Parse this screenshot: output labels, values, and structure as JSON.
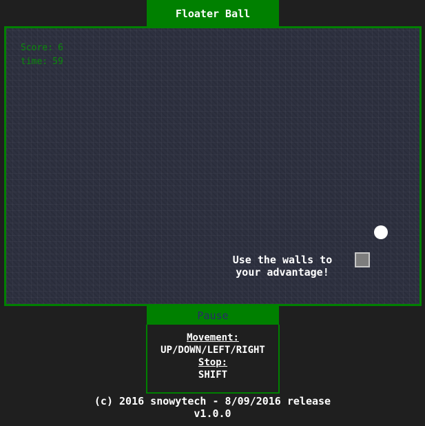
{
  "game": {
    "title": "Floater Ball",
    "hud": {
      "score_label": "Score:",
      "score_value": "6",
      "time_label": "time:",
      "time_value": "59"
    },
    "hint_line1": "Use the walls to",
    "hint_line2": "your advantage!",
    "pause_label": "Pause"
  },
  "controls": {
    "movement_heading": "Movement:",
    "movement_keys": "UP/DOWN/LEFT/RIGHT",
    "stop_heading": "Stop:",
    "stop_key": "SHIFT"
  },
  "footer": {
    "copyright": "(c) 2016 snowytech - 8/09/2016 release",
    "version": "v1.0.0"
  },
  "colors": {
    "accent": "#008000",
    "board_background": "#2e3140",
    "page_background": "#1f1f1f",
    "hud_text": "#0a8a0a",
    "ball": "#ffffff",
    "player": "#7d7d7d"
  }
}
